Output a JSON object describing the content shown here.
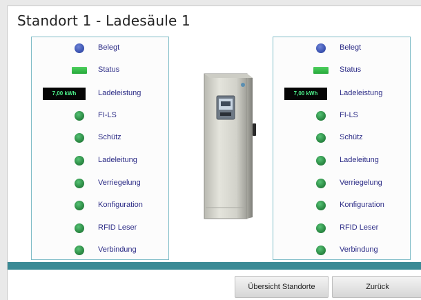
{
  "page": {
    "title": "Standort 1 - Ladesäule 1"
  },
  "left_panel": {
    "occupied_label": "Belegt",
    "status_label": "Status",
    "power_value": "7,00 kWh",
    "power_label": "Ladeleistung",
    "fils_label": "FI-LS",
    "contactor_label": "Schütz",
    "cable_label": "Ladeleitung",
    "lock_label": "Verriegelung",
    "config_label": "Konfiguration",
    "rfid_label": "RFID Leser",
    "connection_label": "Verbindung"
  },
  "right_panel": {
    "occupied_label": "Belegt",
    "status_label": "Status",
    "power_value": "7,00 kWh",
    "power_label": "Ladeleistung",
    "fils_label": "FI-LS",
    "contactor_label": "Schütz",
    "cable_label": "Ladeleitung",
    "lock_label": "Verriegelung",
    "config_label": "Konfiguration",
    "rfid_label": "RFID Leser",
    "connection_label": "Verbindung"
  },
  "indicator_colors": {
    "occupied": "#3d55b3",
    "ok": "#2f8f48",
    "status_bar": "#3cc04e",
    "power_text": "#4df08a"
  },
  "charger": {
    "icon": "charging-station-icon"
  },
  "buttons": {
    "overview_label": "Übersicht Standorte",
    "back_label": "Zurück"
  }
}
